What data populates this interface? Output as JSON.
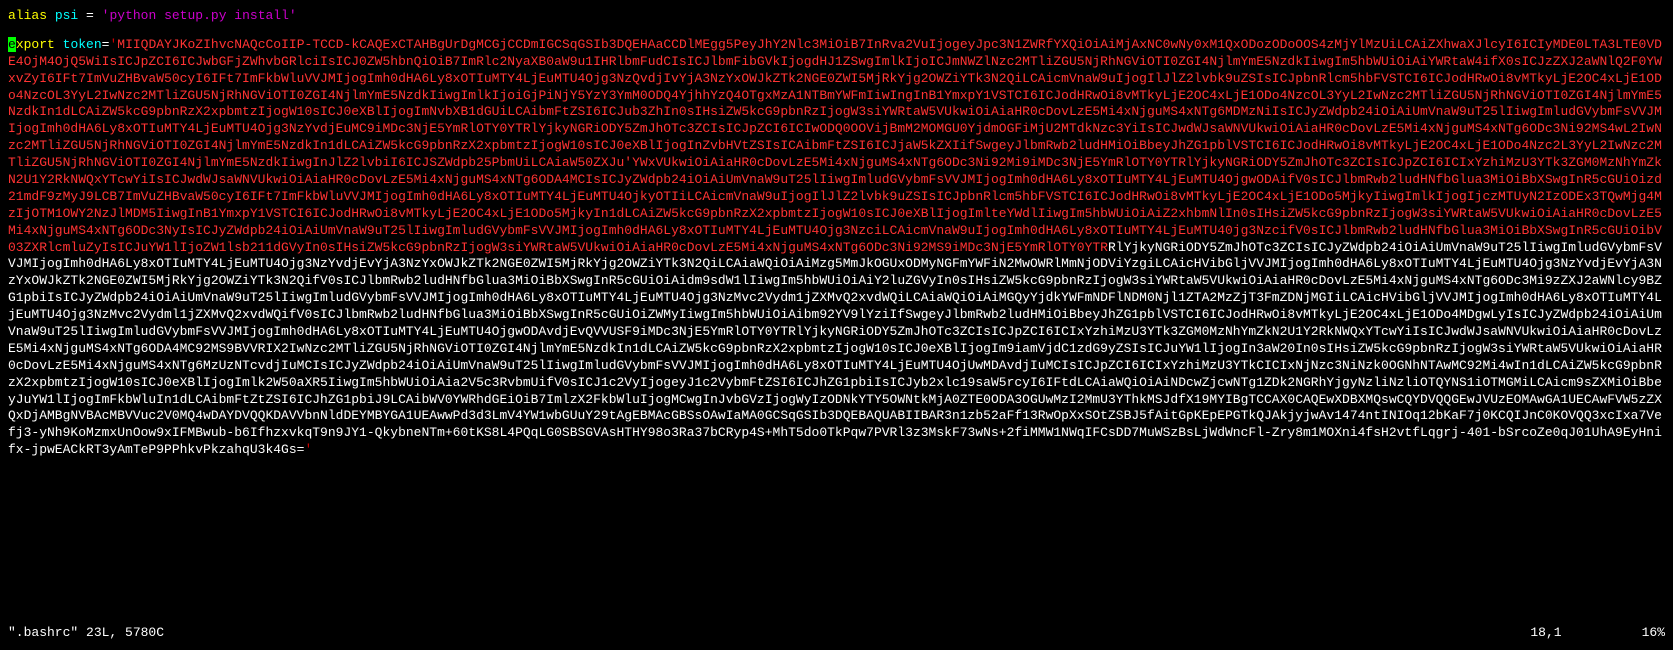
{
  "alias": {
    "keyword": "alias",
    "name": "psi",
    "equals": "=",
    "value": "'python setup.py  install'"
  },
  "export": {
    "cursor_char": "e",
    "keyword_rest": "xport",
    "varname": "token",
    "equals": "=",
    "quote": "'",
    "token_red": "MIIQDAYJKoZIhvcNAQcCoIIP-TCCD-kCAQExCTAHBgUrDgMCGjCCDmIGCSqGSIb3DQEHAaCCDlMEgg5PeyJhY2Nlc3MiOiB7InRva2VuIjogeyJpc3N1ZWRfYXQiOiAiMjAxNC0wNy0xM1QxODozODoOOS4zMjYlMzUiLCAiZXhwaXJlcyI6ICIyMDE0LTA3LTE0VDE4OjM4OjQ5WiIsICJpZCI6ICJwbGFjZWhvbGRlciIsICJ0ZW5hbnQiOiB7ImRlc2NyaXB0aW9u1IHRlbmFudCIsICJlbmFibGVkIjogdHJ1ZSwgImlkIjoICJmNWZlNzc2MTliZGU5NjRhNGViOTI0ZGI4NjlmYmE5NzdkIiwgIm5hbWUiOiAiYWRtaW4ifX0sICJzZXJ2aWNlQ2F0YWxvZyI6IFt7ImVuZHBvaW50cyI6IFt7ImFkbWluVVJMIjogImh0dHA6Ly8xOTIuMTY4LjEuMTU4Ojg3NzQvdjIvYjA3NzYxOWJkZTk2NGE0ZWI5MjRkYjg2OWZiYTk3N2QiLCAicmVnaW9uIjogIlJlZ2lvbk9uZSIsICJpbnRlcm5hbFVSTCI6ICJodHRwOi8vMTkyLjE2OC4xLjE1ODo4NzcOL3YyL2IwNzc2MTliZGU5NjRhNGViOTI0ZGI4NjlmYmE5NzdkIiwgImlkIjoiGjPiNjY5YzY3YmM0ODQ4YjhhYzQ4OTgxMzA1NTBmYWFmIiwIngInB1YmxpY1VSTCI6ICJodHRwOi8vMTkyLjE2OC4xLjE1ODo4NzcOL3YyL2IwNzc2MTliZGU5NjRhNGViOTI0ZGI4NjlmYmE5NzdkIn1dLCAiZW5kcG9pbnRzX2xpbmtzIjogW10sICJ0eXBlIjogImNvbXB1dGUiLCAibmFtZSI6ICJub3ZhIn0sIHsiZW5kcG9pbnRzIjogW3siYWRtaW5VUkwiOiAiaHR0cDovLzE5Mi4xNjguMS4xNTg6MDMzNiIsICJyZWdpb24iOiAiUmVnaW9uT25lIiwgImludGVybmFsVVJMIjogImh0dHA6Ly8xOTIuMTY4LjEuMTU4Ojg3NzYvdjEuMC9iMDc3NjE5YmRlOTY0YTRlYjkyNGRiODY5ZmJhOTc3ZCIsICJpZCI6ICIwODQ0OOVijBmM2MOMGU0YjdmOGFiMjU2MTdkNzc3YiIsICJwdWJsaWNVUkwiOiAiaHR0cDovLzE5Mi4xNjguMS4xNTg6ODc3Ni92MS4wL2IwNzc2MTliZGU5NjRhNGViOTI0ZGI4NjlmYmE5NzdkIn1dLCAiZW5kcG9pbnRzX2xpbmtzIjogW10sICJ0eXBlIjogInZvbHVtZSIsICAibmFtZSI6ICJjaW5kZXIifSwgeyJlbmRwb2ludHMiOiBbeyJhZG1pblVSTCI6ICJodHRwOi8vMTkyLjE2OC4xLjE1ODo4Nzc2L3YyL2IwNzc2MTliZGU5NjRhNGViOTI0ZGI4NjlmYmE5NzdkIiwgInJlZ2lvbiI6ICJSZWdpb25PbmUiLCAiaW50ZXJu'YWxVUkwiOiAiaHR0cDovLzE5Mi4xNjguMS4xNTg6ODc3Ni92Mi9iMDc3NjE5YmRlOTY0YTRlYjkyNGRiODY5ZmJhOTc3ZCIsICJpZCI6ICIxYzhiMzU3YTk3ZGM0MzNhYmZkN2U1Y2RkNWQxYTcwYiIsICJwdWJsaWNVUkwiOiAiaHR0cDovLzE5Mi4xNjguMS4xNTg6ODA4MCIsICJyZWdpb24iOiAiUmVnaW9uT25lIiwgImludGVybmFsVVJMIjogImh0dHA6Ly8xOTIuMTY4LjEuMTU4OjgwODAifV0sICJlbmRwb2ludHNfbGlua3MiOiBbXSwgInR5cGUiOizd21mdF9zMyJ9LCB7ImVuZHBvaW50cyI6IFt7ImFkbWluVVJMIjogImh0dHA6Ly8xOTIuMTY4LjEuMTU4OjkyOTIiLCAicmVnaW9uIjogIlJlZ2lvbk9uZSIsICJpbnRlcm5hbFVSTCI6ICJodHRwOi8vMTkyLjE2OC4xLjE1ODo5MjkyIiwgImlkIjogIjczMTUyN2IzODEx3TQwMjg4MzIjOTM1OWY2NzJlMDM5IiwgInB1YmxpY1VSTCI6ICJodHRwOi8vMTkyLjE2OC4xLjE1ODo5MjkyIn1dLCAiZW5kcG9pbnRzX2xpbmtzIjogW10sICJ0eXBlIjogImlteYWdlIiwgIm5hbWUiOiAiZ2xhbmNlIn0sIHsiZW5kcG9pbnRzIjogW3siYWRtaW5VUkwiOiAiaHR0cDovLzE5Mi4xNjguMS4xNTg6ODc3NyIsICJyZWdpb24iOiAiUmVnaW9uT25lIiwgImludGVybmFsVVJMIjogImh0dHA6Ly8xOTIuMTY4LjEuMTU4Ojg3NzciLCAicmVnaW9uIjogImh0dHA6Ly8xOTIuMTY4LjEuMTU40jg3NzcifV0sICJlbmRwb2ludHNfbGlua3MiOiBbXSwgInR5cGUiOibV03ZXRlcmluZyIsICJuYW1lIjoZW1lsb211dGVyIn0sIHsiZW5kcG9pbnRzIjogW3siYWRtaW5VUkwiOiAiaHR0cDovLzE5Mi4xNjguMS4xNTg6ODc3Ni92MS9iMDc3NjE5YmRlOTY0YTR",
    "token_white": "RlYjkyNGRiODY5ZmJhOTc3ZCIsICJyZWdpb24iOiAiUmVnaW9uT25lIiwgImludGVybmFsVVJMIjogImh0dHA6Ly8xOTIuMTY4LjEuMTU4Ojg3NzYvdjEvYjA3NzYxOWJkZTk2NGE0ZWI5MjRkYjg2OWZiYTk3N2QiLCAiaWQiOiAiMzg5MmJkOGUxODMyNGFmYWFiN2MwOWRlMmNjODViYzgiLCAicHVibGljVVJMIjogImh0dHA6Ly8xOTIuMTY4LjEuMTU4Ojg3NzYvdjEvYjA3NzYxOWJkZTk2NGE0ZWI5MjRkYjg2OWZiYTk3N2QifV0sICJlbmRwb2ludHNfbGlua3MiOiBbXSwgInR5cGUiOiAidm9sdW1lIiwgIm5hbWUiOiAiY2luZGVyIn0sIHsiZW5kcG9pbnRzIjogW3siYWRtaW5VUkwiOiAiaHR0cDovLzE5Mi4xNjguMS4xNTg6ODc3Mi9zZXJ2aWNlcy9BZG1pbiIsICJyZWdpb24iOiAiUmVnaW9uT25lIiwgImludGVybmFsVVJMIjogImh0dHA6Ly8xOTIuMTY4LjEuMTU4Ojg3NzMvc2Vydm1jZXMvQ2xvdWQiLCAiaWQiOiAiMGQyYjdkYWFmNDFlNDM0Njl1ZTA2MzZjT3FmZDNjMGIiLCAicHVibGljVVJMIjogImh0dHA6Ly8xOTIuMTY4LjEuMTU4Ojg3NzMvc2Vydml1jZXMvQ2xvdWQifV0sICJlbmRwb2ludHNfbGlua3MiOiBbXSwgInR5cGUiOiZWMyIiwgIm5hbWUiOiAibm92YV9lYziIfSwgeyJlbmRwb2ludHMiOiBbeyJhZG1pblVSTCI6ICJodHRwOi8vMTkyLjE2OC4xLjE1ODo4MDgwLyIsICJyZWdpb24iOiAiUmVnaW9uT25lIiwgImludGVybmFsVVJMIjogImh0dHA6Ly8xOTIuMTY4LjEuMTU4OjgwODAvdjEvQVVUSF9iMDc3NjE5YmRlOTY0YTRlYjkyNGRiODY5ZmJhOTc3ZCIsICJpZCI6ICIxYzhiMzU3YTk3ZGM0MzNhYmZkN2U1Y2RkNWQxYTcwYiIsICJwdWJsaWNVUkwiOiAiaHR0cDovLzE5Mi4xNjguMS4xNTg6ODA4MC92MS9BVVRIX2IwNzc2MTliZGU5NjRhNGViOTI0ZGI4NjlmYmE5NzdkIn1dLCAiZW5kcG9pbnRzX2xpbmtzIjogW10sICJ0eXBlIjogIm9iamVjdC1zdG9yZSIsICJuYW1lIjogIn3aW20In0sIHsiZW5kcG9pbnRzIjogW3siYWRtaW5VUkwiOiAiaHR0cDovLzE5Mi4xNjguMS4xNTg6MzUzNTcvdjIuMCIsICJyZWdpb24iOiAiUmVnaW9uT25lIiwgImludGVybmFsVVJMIjogImh0dHA6Ly8xOTIuMTY4LjEuMTU4OjUwMDAvdjIuMCIsICJpZCI6ICIxYzhiMzU3YTkCICIxNjNzc3NiNzk0OGNhNTAwMC92Mi4wIn1dLCAiZW5kcG9pbnRzX2xpbmtzIjogW10sICJ0eXBlIjogImlk2W50aXR5IiwgIm5hbWUiOiAia2V5c3RvbmUifV0sICJ1c2VyIjogeyJ1c2VybmFtZSI6ICJhZG1pbiIsICJyb2xlc19saW5rcyI6IFtdLCAiaWQiOiAiNDcwZjcwNTg1ZDk2NGRhYjgyNzliNzliOTQYNS1iOTMGMiLCAicm9sZXMiOiBbeyJuYW1lIjogImFkbWluIn1dLCAibmFtZtZSI6ICJhZG1pbiJ9LCAibWV0YWRhdGEiOiB7ImlzX2FkbWluIjogMCwgInJvbGVzIjogWyIzODNkYTY5OWNtkMjA0ZTE0ODA3OGUwMzI2MmU3YThkMSJdfX19MYIBgTCCAX0CAQEwXDBXMQswCQYDVQQGEwJVUzEOMAwGA1UECAwFVW5zZXQxDjAMBgNVBAcMBVVuc2V0MQ4wDAYDVQQKDAVVbnNldDEYMBYGA1UEAwwPd3d3LmV4YW1wbGUuY29tAgEBMAcGBSsOAwIaMA0GCSqGSIb3DQEBAQUABIIBAR3n1zb52aFf13RwOpXxSOtZSBJ5fAitGpKEpEPGTkQJAkjyjwAv1474ntINIOq12bKaF7j0KCQIJnC0KOVQQ3xcIxa7Vefj3-yNh9KoMzmxUnOow9xIFMBwub-b6IfhzxvkqT9n9JY1-QkybneNTm+60tKS8L4PQqLG0SBSGVAsHTHY98o3Ra37bCRyp4S+MhT5do0TkPqw7PVRl3z3MskF73wNs+2fiMMW1NWqIFCsDD7MuWSzBsLjWdWncFl-Zry8m1MOXni4fsH2vtfLqgrj-401-bSrcoZe0qJ01UhA9EyHnifx-jpwEACkRT3yAmTeP9PPhkvPkzahqU3k4Gs=",
    "quote_end": "'"
  },
  "status": {
    "filename": "\".bashrc\" 23L, 5780C",
    "position": "18,1",
    "percent": "16%"
  }
}
